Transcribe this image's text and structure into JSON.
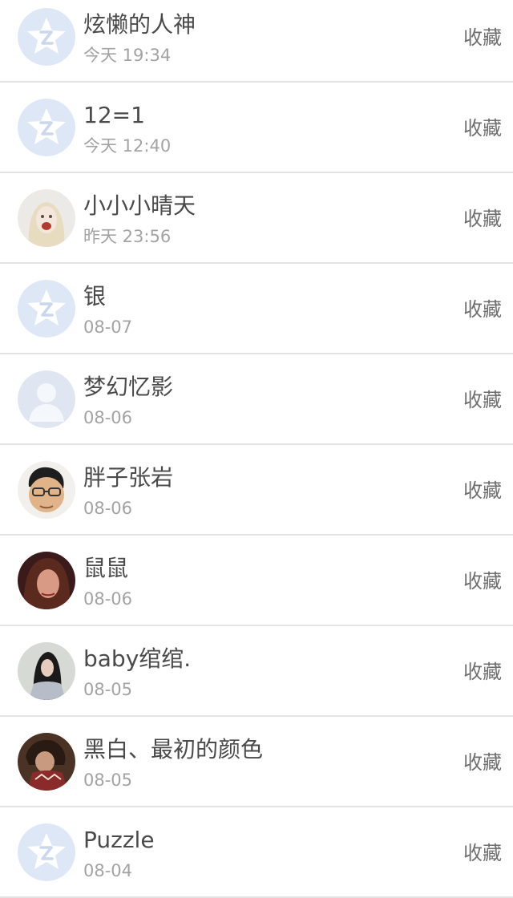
{
  "favorites": [
    {
      "name": "炫懒的人神",
      "time": "今天 19:34",
      "action": "收藏",
      "avatar_icon": "qq-star-default-avatar-icon"
    },
    {
      "name": "12=1",
      "time": "今天 12:40",
      "action": "收藏",
      "avatar_icon": "qq-star-default-avatar-icon"
    },
    {
      "name": "小小小晴天",
      "time": "昨天 23:56",
      "action": "收藏",
      "avatar_icon": "user-photo-avatar-icon"
    },
    {
      "name": "银",
      "time": "08-07",
      "action": "收藏",
      "avatar_icon": "qq-star-default-avatar-icon"
    },
    {
      "name": "梦幻忆影",
      "time": "08-06",
      "action": "收藏",
      "avatar_icon": "person-silhouette-avatar-icon"
    },
    {
      "name": "胖子张岩",
      "time": "08-06",
      "action": "收藏",
      "avatar_icon": "user-photo-avatar-icon"
    },
    {
      "name": "鼠鼠",
      "time": "08-06",
      "action": "收藏",
      "avatar_icon": "user-photo-avatar-icon"
    },
    {
      "name": "baby绾绾.",
      "time": "08-05",
      "action": "收藏",
      "avatar_icon": "user-photo-avatar-icon"
    },
    {
      "name": "黑白、最初的颜色",
      "time": "08-05",
      "action": "收藏",
      "avatar_icon": "user-photo-avatar-icon"
    },
    {
      "name": "Puzzle",
      "time": "08-04",
      "action": "收藏",
      "avatar_icon": "qq-star-default-avatar-icon"
    }
  ],
  "colors": {
    "name_text": "#4a4a4a",
    "time_text": "#a3a3a3",
    "action_text": "#6e6e6e",
    "divider": "#e3e3e6",
    "default_avatar_bg": "#dde7f5"
  }
}
